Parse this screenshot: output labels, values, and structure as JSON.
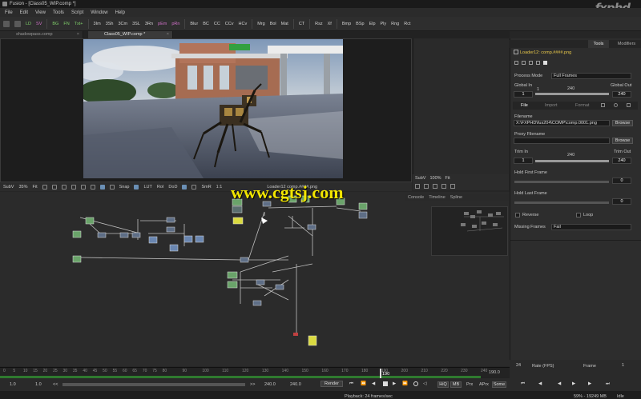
{
  "titlebar": {
    "title": "Fusion - [Class05_WIP.comp *]",
    "watermark": "fxphd"
  },
  "menu": [
    "File",
    "Edit",
    "View",
    "Tools",
    "Script",
    "Window",
    "Help"
  ],
  "toolbar": {
    "items": [
      "LD",
      "SV",
      "BG",
      "FN",
      "Txt+",
      "3Im",
      "3Sh",
      "3Cm",
      "3SL",
      "3Rn",
      "pEm",
      "pRn",
      "Blur",
      "BC",
      "CC",
      "CCv",
      "HCv",
      "Mrg",
      "Bol",
      "Mat",
      "CT",
      "Rsz",
      "Xf",
      "Bmp",
      "BSp",
      "Elp",
      "Ply",
      "Rng",
      "Rct"
    ]
  },
  "doc_tabs": [
    {
      "label": "shadowpass.comp",
      "active": false
    },
    {
      "label": "Class05_WIP.comp *",
      "active": true
    }
  ],
  "viewer": {
    "statusbar": {
      "subview": "SubV",
      "zoom": "35%",
      "fit": "Fit",
      "snap": "Snap",
      "lut": "LUT",
      "roi": "RoI",
      "dod": "DoD",
      "smr": "SmR",
      "ratio": "1:1",
      "loader": "Loader12 comp.####.png"
    }
  },
  "viewer2": {
    "subview": "SubV",
    "zoom": "100%",
    "fit": "Fit"
  },
  "flow_tabs": [
    "Console",
    "Timeline",
    "Spline"
  ],
  "inspector": {
    "tabs": [
      "Tools",
      "Modifiers"
    ],
    "node_name": "Loader12: comp.####.png",
    "process_mode_label": "Process Mode",
    "process_mode_value": "Full Frames",
    "global_in_label": "Global In",
    "global_out_label": "Global Out",
    "global_in": "1",
    "global_mid": "240",
    "global_out": "240",
    "global_left": "1",
    "sub_tabs": [
      "File",
      "Import",
      "Format"
    ],
    "filename_label": "Filename",
    "filename_value": "X:\\FXPHD\\fus204\\COMP\\comp.0001.png",
    "browse": "Browse",
    "proxy_label": "Proxy Filename",
    "trim_in_label": "Trim In",
    "trim_out_label": "Trim Out",
    "trim_in": "1",
    "trim_mid": "240",
    "trim_out": "240",
    "hold_first_label": "Hold First Frame",
    "hold_first_value": "0",
    "hold_last_label": "Hold Last Frame",
    "hold_last_value": "0",
    "reverse_label": "Reverse",
    "loop_label": "Loop",
    "missing_frames_label": "Missing Frames",
    "missing_frames_value": "Fail"
  },
  "timeline": {
    "ticks": [
      "0",
      "5",
      "10",
      "15",
      "20",
      "25",
      "30",
      "35",
      "40",
      "45",
      "50",
      "55",
      "60",
      "65",
      "70",
      "75",
      "80",
      "90",
      "100",
      "110",
      "120",
      "130",
      "140",
      "150",
      "160",
      "170",
      "180",
      "190",
      "200",
      "210",
      "220",
      "230",
      "240"
    ],
    "current": "190",
    "end_display": "190.0"
  },
  "transport": {
    "start": "1.0",
    "start2": "1.0",
    "end": "240.0",
    "end2": "240.0",
    "render": "Render",
    "hiq": "HiQ",
    "mb": "MB",
    "prx": "Prx",
    "aprx": "APrx",
    "some": "Some"
  },
  "bottom_right": {
    "frame_count": "24",
    "rate_label": "Rate (FPS)",
    "frame_label": "Frame",
    "frame_value": "1"
  },
  "status": {
    "playback": "Playback: 24 frames/sec",
    "memory": "59% - 19249 MB",
    "state": "Idle"
  },
  "overlay_watermark": "www.cgtsj.com"
}
